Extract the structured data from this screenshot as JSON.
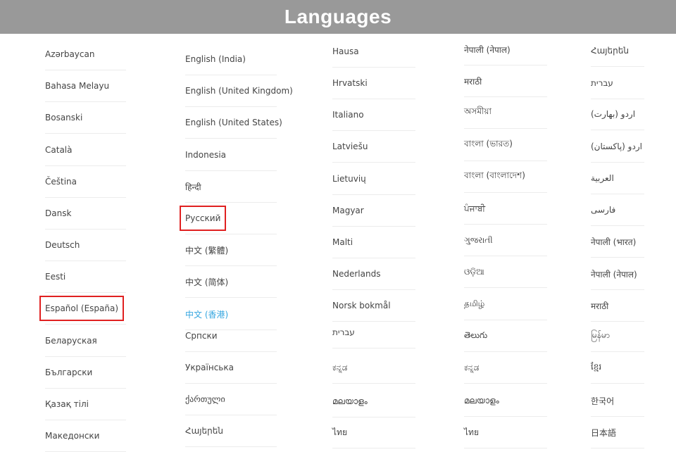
{
  "header": {
    "title": "Languages"
  },
  "colors": {
    "header_bg": "#999999",
    "highlight": "#e02020",
    "active_text": "#35a6e0"
  },
  "columns": [
    {
      "items": [
        {
          "label": "Azərbaycan"
        },
        {
          "label": "Bahasa Melayu"
        },
        {
          "label": "Bosanski"
        },
        {
          "label": "Català"
        },
        {
          "label": "Čeština"
        },
        {
          "label": "Dansk"
        },
        {
          "label": "Deutsch"
        },
        {
          "label": "Eesti"
        },
        {
          "label": "Español (España)",
          "highlighted": true
        },
        {
          "label": "Беларуская"
        },
        {
          "label": "Български"
        },
        {
          "label": "Қазақ тілі"
        },
        {
          "label": "Македонски"
        }
      ]
    },
    {
      "items": [
        {
          "label": "English (India)"
        },
        {
          "label": "English (United Kingdom)"
        },
        {
          "label": "English (United States)"
        },
        {
          "label": "Indonesia"
        },
        {
          "label": "हिन्दी"
        },
        {
          "label": "Русский",
          "highlighted": true
        },
        {
          "label": "中文 (繁體)"
        },
        {
          "label": "中文 (简体)"
        },
        {
          "label": "中文 (香港)",
          "active": true
        },
        {
          "label": "Српски"
        },
        {
          "label": "Українська"
        },
        {
          "label": "ქართული"
        },
        {
          "label": "Հայերեն"
        }
      ]
    },
    {
      "items": [
        {
          "label": "Hausa"
        },
        {
          "label": "Hrvatski"
        },
        {
          "label": "Italiano"
        },
        {
          "label": "Latviešu"
        },
        {
          "label": "Lietuvių"
        },
        {
          "label": "Magyar"
        },
        {
          "label": "Malti"
        },
        {
          "label": "Nederlands"
        },
        {
          "label": "Norsk bokmål"
        },
        {
          "label": "עברית"
        },
        {
          "label": "ಕನ್ನಡ"
        },
        {
          "label": "മലയാളം"
        },
        {
          "label": "ไทย"
        }
      ]
    },
    {
      "items": [
        {
          "label": "नेपाली (नेपाल)"
        },
        {
          "label": "मराठी"
        },
        {
          "label": "অসমীয়া"
        },
        {
          "label": "বাংলা (ভারত)"
        },
        {
          "label": "বাংলা (বাংলাদেশ)"
        },
        {
          "label": "ਪੰਜਾਬੀ"
        },
        {
          "label": "ગુજરાતી"
        },
        {
          "label": "ଓଡ଼ିଆ"
        },
        {
          "label": "தமிழ்"
        },
        {
          "label": "తెలుగు"
        },
        {
          "label": "ಕನ್ನಡ"
        },
        {
          "label": "മലയാളം"
        },
        {
          "label": "ไทย"
        }
      ]
    },
    {
      "items": [
        {
          "label": "Հայերեն"
        },
        {
          "label": "עברית"
        },
        {
          "label": "اردو (بھارت)"
        },
        {
          "label": "اردو (پاکستان)"
        },
        {
          "label": "العربية"
        },
        {
          "label": "فارسی"
        },
        {
          "label": "नेपाली (भारत)"
        },
        {
          "label": "नेपाली (नेपाल)"
        },
        {
          "label": "मराठी"
        },
        {
          "label": "မြန်မာ"
        },
        {
          "label": "ខ្មែរ"
        },
        {
          "label": "한국어"
        },
        {
          "label": "日本語"
        }
      ]
    }
  ]
}
